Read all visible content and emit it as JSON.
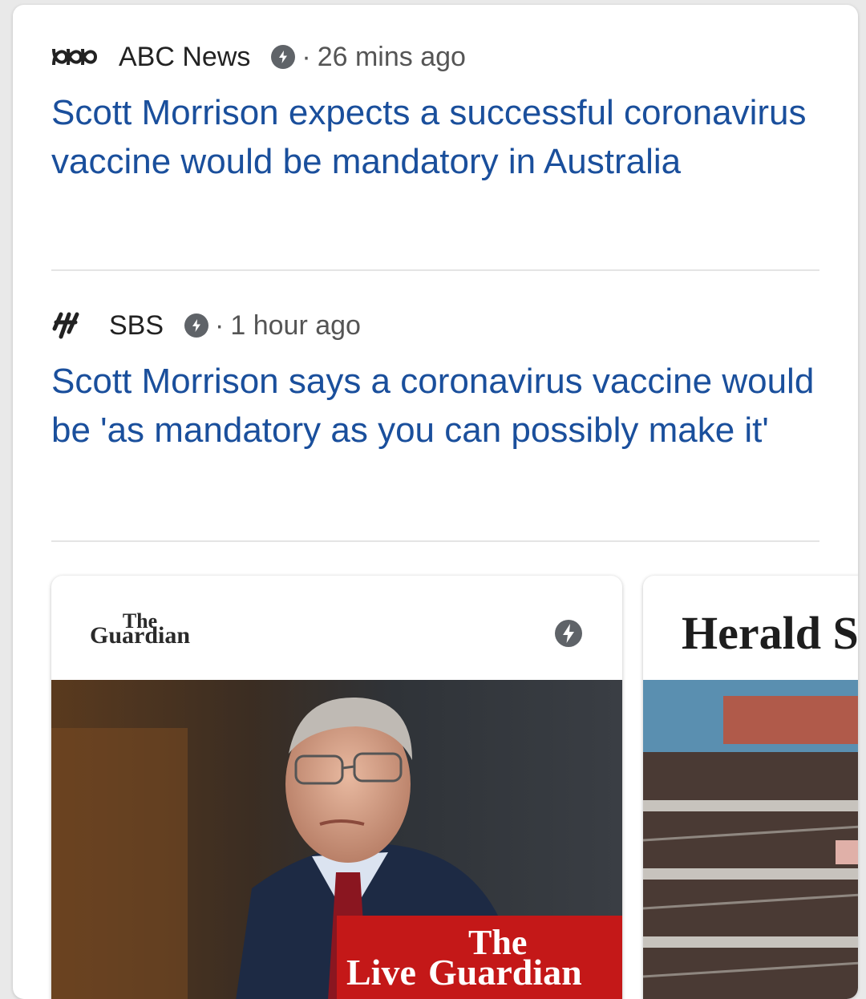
{
  "stories": [
    {
      "source": "ABC News",
      "logo_icon": "abc-news-logo-icon",
      "amp_icon": "amp-lightning-icon",
      "separator": "·",
      "time": "26 mins ago",
      "headline": "Scott Morrison expects a successful coronavirus vaccine would be mandatory in Australia"
    },
    {
      "source": "SBS",
      "logo_icon": "sbs-logo-icon",
      "amp_icon": "amp-lightning-icon",
      "separator": "·",
      "time": "1 hour ago",
      "headline": "Scott Morrison says a coronavirus vaccine would be 'as mandatory as you can possibly make it'"
    }
  ],
  "carousel": [
    {
      "publisher_the": "The",
      "publisher_name": "Guardian",
      "amp_icon": "amp-lightning-icon",
      "image": "scott-morrison-photo",
      "badge_the": "The",
      "badge_live": "Live",
      "badge_name": "Guardian"
    },
    {
      "publisher_name": "Herald S",
      "image": "empty-supermarket-shelves-photo"
    }
  ],
  "colors": {
    "headline": "#1a4f9c",
    "badge": "#c41818",
    "amp": "#5f6368"
  }
}
